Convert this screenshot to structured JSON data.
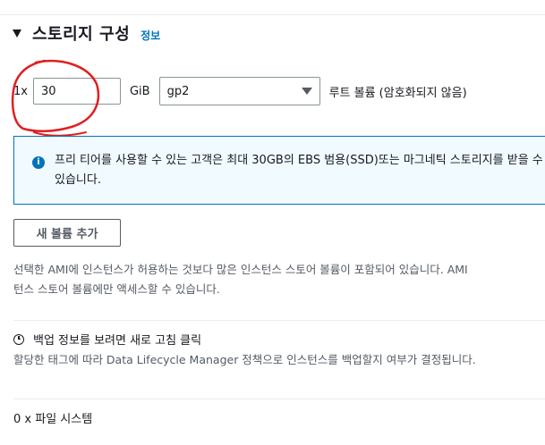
{
  "storage": {
    "title": "스토리지 구성",
    "info_link": "정보",
    "volume": {
      "multiplier": "1x",
      "size": "30",
      "unit": "GiB",
      "type": "gp2",
      "label": "루트 볼륨  (암호화되지 않음)"
    },
    "free_tier_info": "프리 티어를 사용할 수 있는 고객은 최대 30GB의 EBS 범용(SSD)또는 마그네틱 스토리지를 받을 수 있습니다.",
    "add_volume_button": "새 볼륨 추가",
    "ami_desc_line1": "선택한 AMI에 인스턴스가 허용하는 것보다 많은 인스턴스 스토어 볼륨이 포함되어 있습니다. AMI",
    "ami_desc_line2": "턴스 스토어 볼륨에만 액세스할 수 있습니다.",
    "backup_title": "백업 정보를 보려면 새로 고침 클릭",
    "backup_desc": "할당한 태그에 따라 Data Lifecycle Manager 정책으로 인스턴스를 백업할지 여부가 결정됩니다.",
    "file_systems": "0 x 파일 시스템"
  },
  "colors": {
    "link": "#0073bb",
    "annotation": "#e02020",
    "info_bg": "#f1faff"
  },
  "icons": [
    "caret-down-icon",
    "info-circle-icon",
    "dropdown-arrow-icon",
    "clock-icon"
  ]
}
